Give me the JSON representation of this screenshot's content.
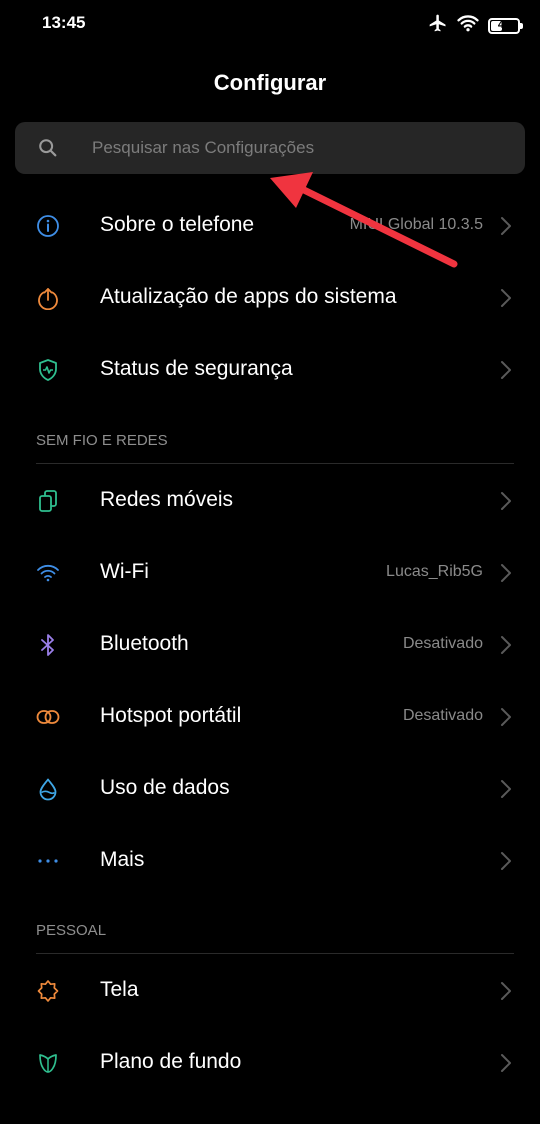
{
  "status_bar": {
    "time": "13:45",
    "battery": "42",
    "battery_level": 0.42,
    "icons": [
      "airplane-icon",
      "wifi-icon",
      "battery-icon"
    ]
  },
  "header": {
    "title": "Configurar"
  },
  "search": {
    "placeholder": "Pesquisar nas Configurações"
  },
  "items_top": [
    {
      "label": "Sobre o telefone",
      "value": "MIUI Global 10.3.5",
      "icon": "info-icon",
      "color": "#3f8ee6"
    },
    {
      "label": "Atualização de apps do sistema",
      "value": "",
      "icon": "upload-icon",
      "color": "#ef8a3c"
    },
    {
      "label": "Status de segurança",
      "value": "",
      "icon": "shield-icon",
      "color": "#2fbf8f"
    }
  ],
  "section_wireless": "SEM FIO E REDES",
  "items_wireless": [
    {
      "label": "Redes móveis",
      "value": "",
      "icon": "sim-card-icon",
      "color": "#2fbf8f"
    },
    {
      "label": "Wi-Fi",
      "value": "Lucas_Rib5G",
      "icon": "wifi-icon",
      "color": "#3f8ee6"
    },
    {
      "label": "Bluetooth",
      "value": "Desativado",
      "icon": "bluetooth-icon",
      "color": "#9a7ee8"
    },
    {
      "label": "Hotspot portátil",
      "value": "Desativado",
      "icon": "hotspot-icon",
      "color": "#ef8a3c"
    },
    {
      "label": "Uso de dados",
      "value": "",
      "icon": "droplet-icon",
      "color": "#3fa7e6"
    },
    {
      "label": "Mais",
      "value": "",
      "icon": "more-dots-icon",
      "color": "#3f8ee6"
    }
  ],
  "section_personal": "PESSOAL",
  "items_personal": [
    {
      "label": "Tela",
      "value": "",
      "icon": "brightness-icon",
      "color": "#ef8a3c"
    },
    {
      "label": "Plano de fundo",
      "value": "",
      "icon": "wallpaper-icon",
      "color": "#2fbf8f"
    }
  ],
  "annotation": {
    "color": "#f0343f"
  }
}
